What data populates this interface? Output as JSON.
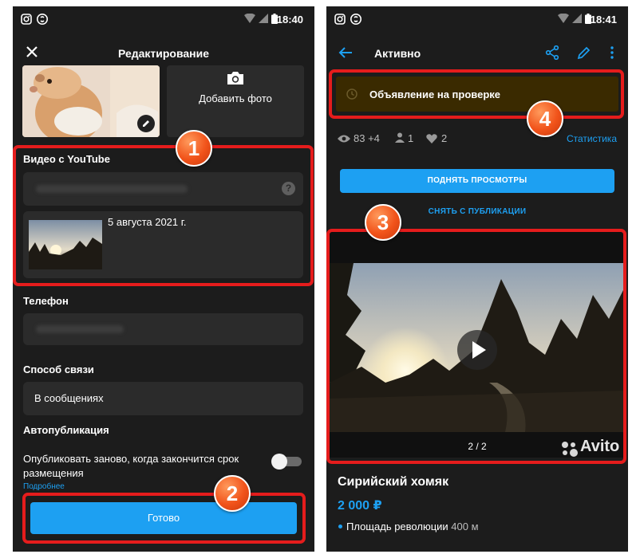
{
  "status_left": {
    "time": "18:40"
  },
  "status_right": {
    "time": "18:41"
  },
  "left": {
    "title": "Редактирование",
    "add_photo_label": "Добавить фото",
    "video_section_label": "Видео с YouTube",
    "video_date": "5 августа 2021 г.",
    "phone_label": "Телефон",
    "contact_method_label": "Способ связи",
    "contact_method_value": "В сообщениях",
    "autopublish_label": "Автопубликация",
    "autopublish_text": "Опубликовать заново, когда закончится срок размещения",
    "more_link": "Подробнее",
    "done_button": "Готово",
    "autopublish_enabled": false
  },
  "right": {
    "title": "Активно",
    "review_banner": "Объявление на проверке",
    "stats": {
      "views": "83 +4",
      "contacts": "1",
      "favorites": "2"
    },
    "statistics_link": "Статистика",
    "raise_views_button": "ПОДНЯТЬ ПРОСМОТРЫ",
    "unpublish_link": "СНЯТЬ С ПУБЛИКАЦИИ",
    "gallery_counter": "2 / 2",
    "watermark": "Avito",
    "listing_title": "Сирийский хомяк",
    "price": "2 000 ₽",
    "metro_station": "Площадь революции",
    "metro_distance": "400 м"
  },
  "badges": [
    "1",
    "2",
    "3",
    "4"
  ],
  "colors": {
    "accent": "#1da0f2",
    "highlight": "#e51c1c",
    "badge": "#f1531a",
    "banner": "#3a2a00"
  }
}
